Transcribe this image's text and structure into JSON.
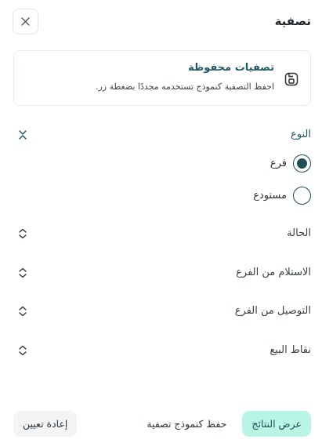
{
  "header": {
    "title": "تصفية",
    "close_icon": "close-icon"
  },
  "saved_filters": {
    "title": "تصفيات محفوظة",
    "description": "احفظ التصفية كنموذج تستخدمه مجددًا بضغطة زر.",
    "icon": "save-icon"
  },
  "type_section": {
    "title": "النوع",
    "expanded": true,
    "options": [
      {
        "label": "فرع",
        "selected": true
      },
      {
        "label": "مستودع",
        "selected": false
      }
    ]
  },
  "sections": [
    {
      "title": "الحالة"
    },
    {
      "title": "الاستلام من الفرع"
    },
    {
      "title": "التوصيل من الفرع"
    },
    {
      "title": "نقاط البيع"
    }
  ],
  "footer": {
    "show_results": "عرض النتائج",
    "save_template": "حفظ كنموذج تصفية",
    "reset": "إعادة تعيين"
  },
  "colors": {
    "accent": "#1f5863",
    "primary_button_bg": "#b9f5e5"
  }
}
